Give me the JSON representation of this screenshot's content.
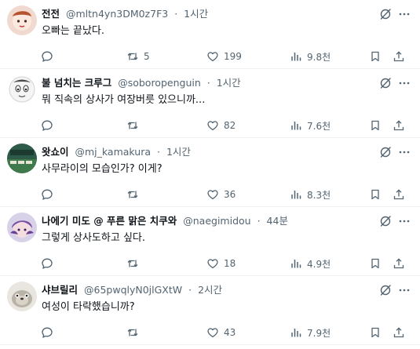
{
  "tweets": [
    {
      "name": "전전",
      "handle": "@mltn4yn3DM0z7F3",
      "time": "1시간",
      "text": "오빠는 끝났다.",
      "replies": "",
      "retweets": "5",
      "likes": "199",
      "views": "9.8천"
    },
    {
      "name": "불 넘치는 크루그",
      "handle": "@soboropenguin",
      "time": "1시간",
      "text": "뭐 직속의 상사가 여장버릇 있으니까...",
      "replies": "",
      "retweets": "",
      "likes": "82",
      "views": "7.6천"
    },
    {
      "name": "왓쇼이",
      "handle": "@mj_kamakura",
      "time": "1시간",
      "text": "사무라이의 모습인가? 이게?",
      "replies": "",
      "retweets": "",
      "likes": "36",
      "views": "8.3천"
    },
    {
      "name": "나에기 미도 @ 푸른 맑은 치쿠와",
      "handle": "@naegimidou",
      "time": "44분",
      "text": "그렇게 상사도하고 싶다.",
      "replies": "",
      "retweets": "",
      "likes": "18",
      "views": "4.9천"
    },
    {
      "name": "샤브릴리",
      "handle": "@65pwqlyN0jlGXtW",
      "time": "2시간",
      "text": "여성이 타락했습니까?",
      "replies": "",
      "retweets": "",
      "likes": "43",
      "views": "7.9천"
    }
  ],
  "separator": "·",
  "icons": {
    "reply": "reply-icon",
    "retweet": "retweet-icon",
    "like": "heart-icon",
    "views": "views-icon",
    "bookmark": "bookmark-icon",
    "share": "share-icon",
    "grok": "grok-icon",
    "more": "more-icon"
  },
  "colors": {
    "text": "#0f1419",
    "secondary": "#536471",
    "border": "#eff3f4"
  }
}
